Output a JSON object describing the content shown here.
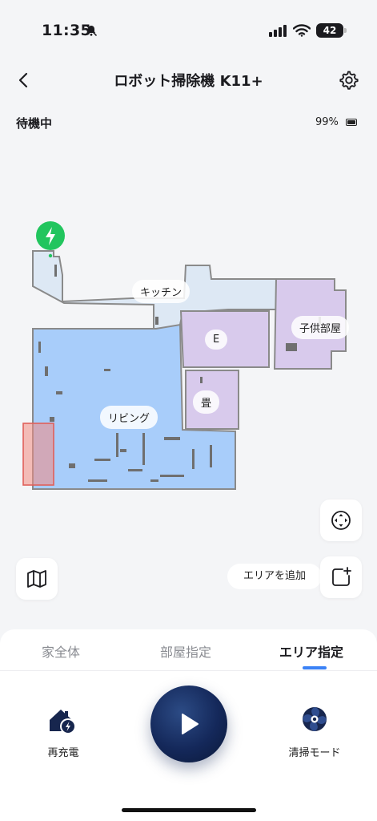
{
  "status_bar": {
    "time": "11:35",
    "battery": "42"
  },
  "header": {
    "title": "ロボット掃除機 K11+"
  },
  "device": {
    "state": "待機中",
    "battery_percent": "99%"
  },
  "map": {
    "rooms": {
      "kitchen": "キッチン",
      "e": "E",
      "kids_room": "子供部屋",
      "tatami": "畳",
      "living": "リビング"
    }
  },
  "actions": {
    "add_area": "エリアを追加"
  },
  "tabs": [
    {
      "label": "家全体"
    },
    {
      "label": "部屋指定"
    },
    {
      "label": "エリア指定",
      "active": true
    }
  ],
  "controls": {
    "recharge": "再充電",
    "clean_mode": "清掃モード"
  },
  "colors": {
    "accent": "#3b82f6",
    "charger": "#22c55e",
    "living_room": "#a8cdfa",
    "kitchen": "#dde8f4",
    "bedroom": "#d8caec",
    "zone": "#f28b82",
    "play_button": "#14285a"
  },
  "icons": {
    "back": "chevron-left-icon",
    "settings": "gear-icon",
    "recenter": "crosshair-icon",
    "map": "map-icon",
    "add_area": "add-square-icon",
    "recharge": "home-charge-icon",
    "clean_mode": "fan-icon",
    "play": "play-icon"
  }
}
